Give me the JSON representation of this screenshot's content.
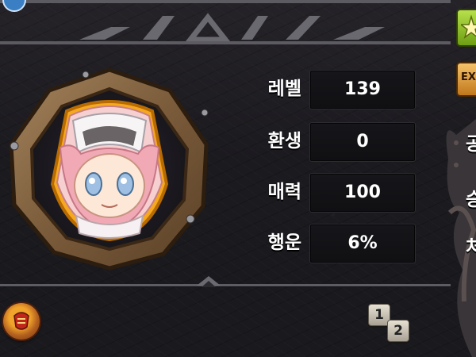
{
  "character": {
    "portrait_icon": "pink-haired-character-portrait"
  },
  "stats": [
    {
      "label": "레벨",
      "value": "139"
    },
    {
      "label": "환생",
      "value": "0"
    },
    {
      "label": "매력",
      "value": "100"
    },
    {
      "label": "행운",
      "value": "6%"
    }
  ],
  "side_panel": {
    "buttons": [
      {
        "icon": "green-star-icon",
        "color": "#9ccf31"
      },
      {
        "icon": "exp-badge-icon",
        "label": "EX",
        "color": "#e6a23c"
      }
    ],
    "partial_labels": [
      "공",
      "승",
      "처"
    ]
  },
  "bottom": {
    "round_badge_icon": "red-seal-icon",
    "page_toggle": {
      "first": "1",
      "second": "2"
    }
  },
  "colors": {
    "frame_wood": "#8b6c4a",
    "frame_gold": "#f2b632",
    "stat_box": "#141417"
  }
}
